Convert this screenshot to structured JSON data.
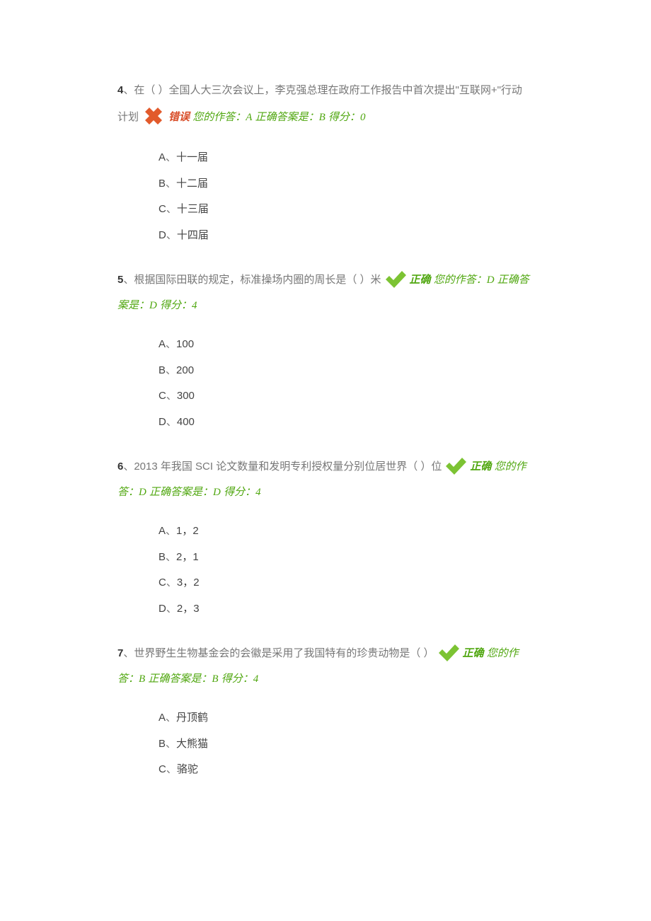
{
  "labels": {
    "wrong": "错误",
    "right": "正确",
    "your_answer_prefix": "您的作答：",
    "correct_answer_prefix": "正确答案是：",
    "score_prefix": "得分：",
    "sep": "、"
  },
  "questions": [
    {
      "num": "4",
      "text_a": "、在（ ）全国人大三次会议上，李克强总理在政府工作报告中首次提出\"互联网+\"行动计划",
      "status": "wrong",
      "your_answer": "A",
      "correct_answer": "B",
      "score": "0",
      "break_before_correct": false,
      "options": [
        {
          "letter": "A",
          "text": "十一届"
        },
        {
          "letter": "B",
          "text": "十二届"
        },
        {
          "letter": "C",
          "text": "十三届"
        },
        {
          "letter": "D",
          "text": "十四届"
        }
      ]
    },
    {
      "num": "5",
      "text_a": "、根据国际田联的规定，标准操场内圈的周长是（ ）米",
      "status": "right",
      "your_answer": "D",
      "correct_answer": "D",
      "score": "4",
      "break_before_correct": false,
      "options": [
        {
          "letter": "A",
          "text": "100"
        },
        {
          "letter": "B",
          "text": "200"
        },
        {
          "letter": "C",
          "text": "300"
        },
        {
          "letter": "D",
          "text": "400"
        }
      ]
    },
    {
      "num": "6",
      "text_a": "、2013 年我国 SCI 论文数量和发明专利授权量分别位居世界（ ）位",
      "status": "right",
      "your_answer": "D",
      "correct_answer": "D",
      "score": "4",
      "break_before_correct": false,
      "options": [
        {
          "letter": "A",
          "text": "1，2"
        },
        {
          "letter": "B",
          "text": "2，1"
        },
        {
          "letter": "C",
          "text": "3，2"
        },
        {
          "letter": "D",
          "text": "2，3"
        }
      ]
    },
    {
      "num": "7",
      "text_a": "、世界野生生物基金会的会徽是采用了我国特有的珍贵动物是（ ）",
      "status": "right",
      "your_answer": "B",
      "correct_answer": "B",
      "score": "4",
      "break_before_correct": false,
      "options": [
        {
          "letter": "A",
          "text": "丹顶鹤"
        },
        {
          "letter": "B",
          "text": "大熊猫"
        },
        {
          "letter": "C",
          "text": "骆驼"
        }
      ]
    }
  ]
}
